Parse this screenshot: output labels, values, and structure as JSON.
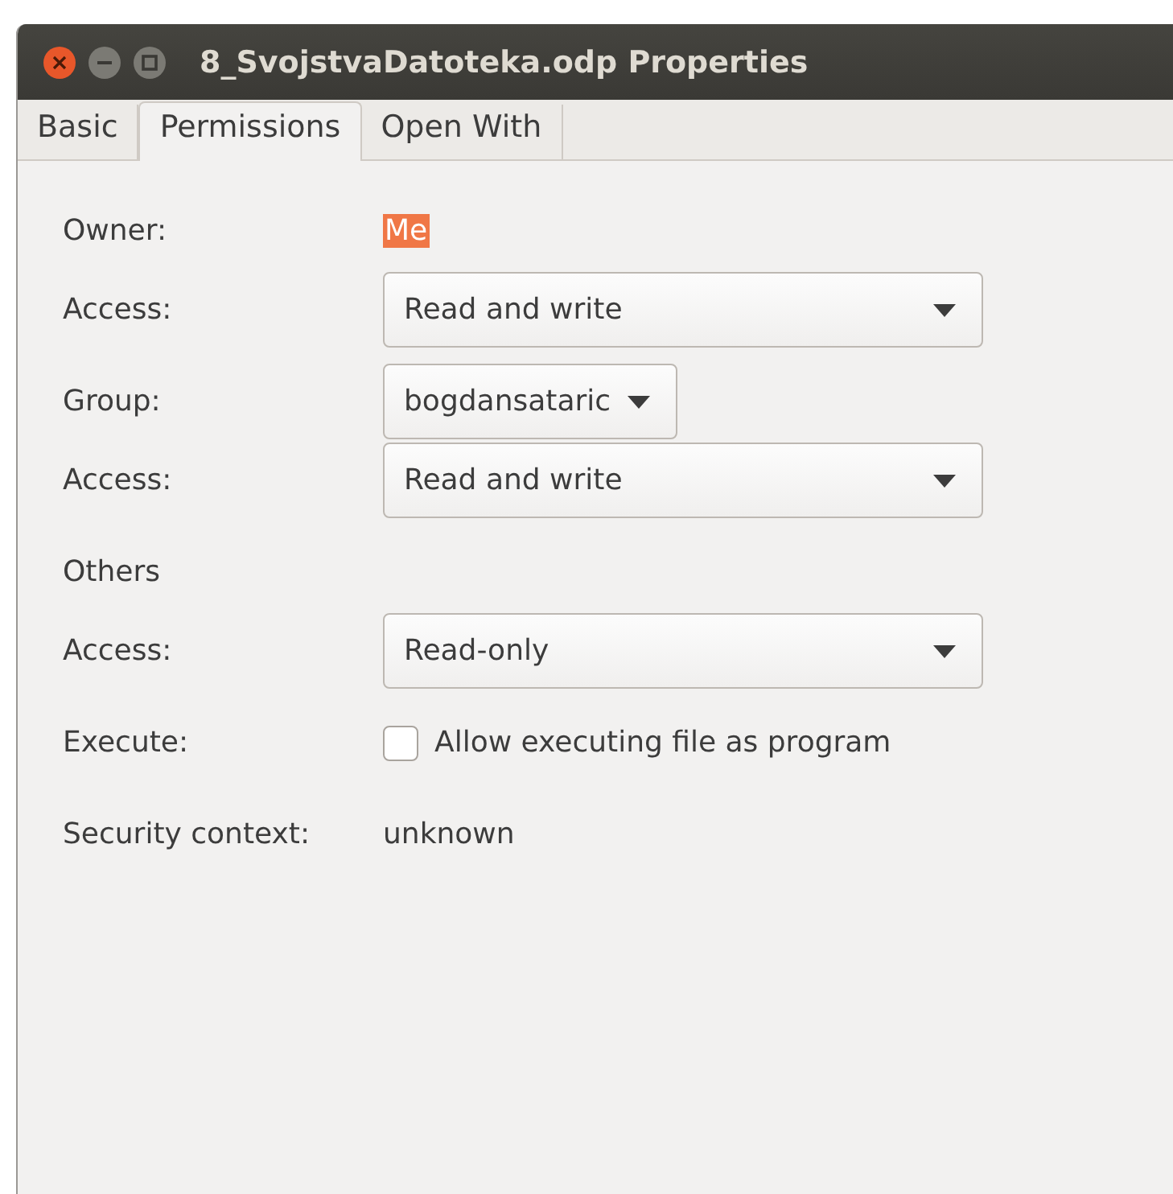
{
  "window": {
    "title": "8_SvojstvaDatoteka.odp Properties"
  },
  "tabs": [
    {
      "label": "Basic",
      "selected": false
    },
    {
      "label": "Permissions",
      "selected": true
    },
    {
      "label": "Open With",
      "selected": false
    }
  ],
  "sections": [
    {
      "rows": [
        {
          "kind": "value",
          "label": "Owner:",
          "value": "Me",
          "selected": true
        },
        {
          "kind": "combo",
          "label": "Access:",
          "value": "Read and write"
        }
      ]
    },
    {
      "rows": [
        {
          "kind": "menu_button",
          "label": "Group:",
          "value": "bogdansataric"
        },
        {
          "kind": "combo",
          "label": "Access:",
          "value": "Read and write"
        }
      ]
    },
    {
      "rows": [
        {
          "kind": "heading",
          "label": "Others"
        },
        {
          "kind": "combo",
          "label": "Access:",
          "value": "Read-only"
        }
      ]
    },
    {
      "rows": [
        {
          "kind": "checkbox",
          "label": "Execute:",
          "value": "Allow executing file as program",
          "checked": false
        }
      ]
    },
    {
      "rows": [
        {
          "kind": "value",
          "label": "Security context:",
          "value": "unknown",
          "selected": false
        }
      ]
    }
  ]
}
